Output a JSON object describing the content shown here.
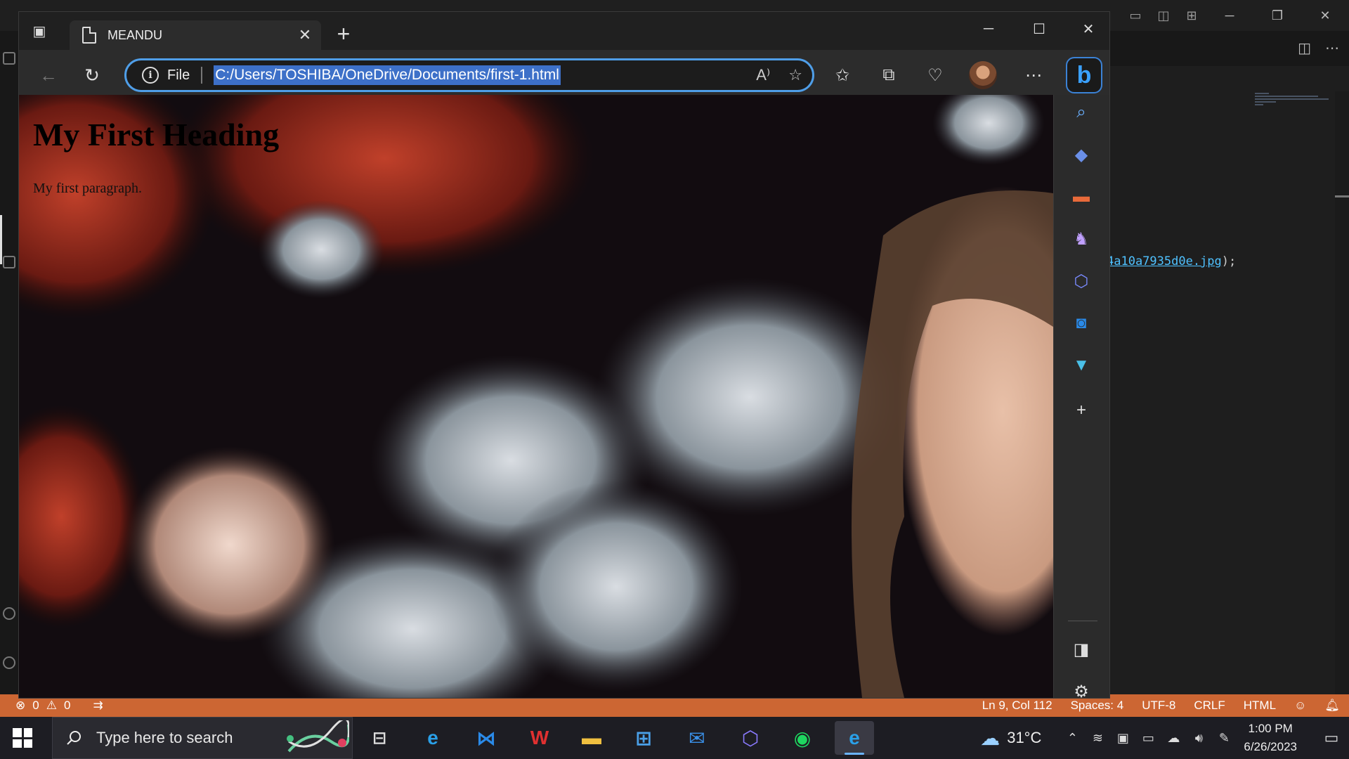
{
  "browser": {
    "tab_title": "MEANDU",
    "address_label": "File",
    "url": "C:/Users/TOSHIBA/OneDrive/Documents/first-1.html"
  },
  "page": {
    "heading": "My First Heading",
    "paragraph": "My first paragraph."
  },
  "editor": {
    "code_prefix": "4a10a7935d0e.jpg",
    "code_suffix": ");"
  },
  "statusbar": {
    "errors": "0",
    "warnings": "0",
    "position": "Ln 9, Col 112",
    "spaces": "Spaces: 4",
    "encoding": "UTF-8",
    "eol": "CRLF",
    "language": "HTML"
  },
  "taskbar": {
    "search_placeholder": "Type here to search",
    "temperature": "31°C",
    "time": "1:00 PM",
    "date": "6/26/2023"
  },
  "colors": {
    "accent": "#3d70c8",
    "statusbar": "#cc6633",
    "edge_blue": "#4f9ee8"
  }
}
